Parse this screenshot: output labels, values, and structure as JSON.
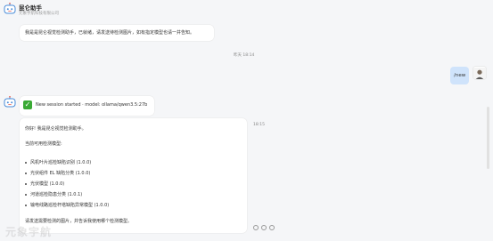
{
  "header": {
    "title": "昆仑助手",
    "subtitle": "元象宇航科技有限公司"
  },
  "messages": {
    "bot_greeting": "我是是昆仑视觉检测助手，已就绪，请发送待检测图片，如有指定模型也请一并告知。",
    "time_1": "昨天 18:14",
    "user_command": "/new",
    "session_status": "New session started · model: ollama/qwen3.5:27b",
    "time_2": "18:15",
    "reply": {
      "hello": "你好! 我是昆仑视觉检测助手。",
      "models_heading": "当前可用检测模型:",
      "models": [
        "风机叶片巡检缺陷识别 (1.0.0)",
        "光伏组件 EL 缺陷分类 (1.0.0)",
        "光伏模型 (1.0.0)",
        "河道巡检隐患分类 (1.0.1)",
        "输电线路巡检杆塔缺陷异常模型 (1.0.0)"
      ],
      "closing": "请发送需要检测的图片，并告诉我使用哪个检测模型。"
    }
  },
  "watermark": "元象宇航",
  "colors": {
    "background": "#f5f6f8",
    "user_bubble": "#cfe3fb",
    "check_green": "#3aaa35"
  },
  "icons": {
    "bot_avatar": "robot-icon",
    "user_avatar": "user-photo",
    "status": "check-mark-icon",
    "actions": [
      "copy-icon",
      "refresh-icon",
      "more-icon"
    ]
  }
}
